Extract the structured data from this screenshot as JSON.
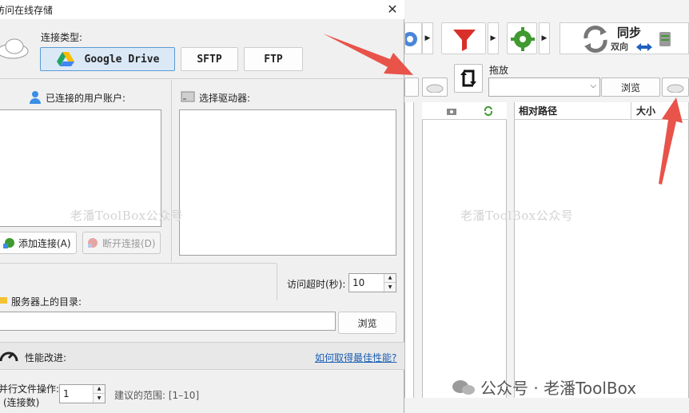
{
  "dialog": {
    "title": "访问在线存储",
    "close_glyph": "✕",
    "connection_type_label": "连接类型:",
    "services": [
      "Google Drive",
      "SFTP",
      "FTP"
    ],
    "connected_accounts_label": "已连接的用户账户:",
    "select_drive_label": "选择驱动器:",
    "add_connection_label": "添加连接(A)",
    "disconnect_label": "断开连接(D)",
    "timeout_label": "访问超时(秒):",
    "timeout_value": "10",
    "server_dir_label": "服务器上的目录:",
    "server_dir_value": "",
    "browse_label": "浏览",
    "perf_label": "性能改进:",
    "perf_link": "如何取得最佳性能?",
    "parallel_label_1": "并行文件操作:",
    "parallel_label_2": "(连接数)",
    "parallel_value": "1",
    "range_hint": "建议的范围: [1–10]"
  },
  "app": {
    "sync_title": "同步",
    "sync_sub": "双向",
    "drag_label": "拖放",
    "drag_value": "",
    "browse_label": "浏览",
    "col_relative_path": "相对路径",
    "col_size": "大小"
  },
  "watermarks": {
    "left": "老潘ToolBox公众号",
    "right": "老潘ToolBox公众号",
    "wechat": "公众号 · 老潘ToolBox"
  },
  "colors": {
    "accent_blue": "#5c9ad6",
    "arrow_red": "#e8534a",
    "filter_red": "#d9302a",
    "gear_green": "#3f9a2f"
  }
}
